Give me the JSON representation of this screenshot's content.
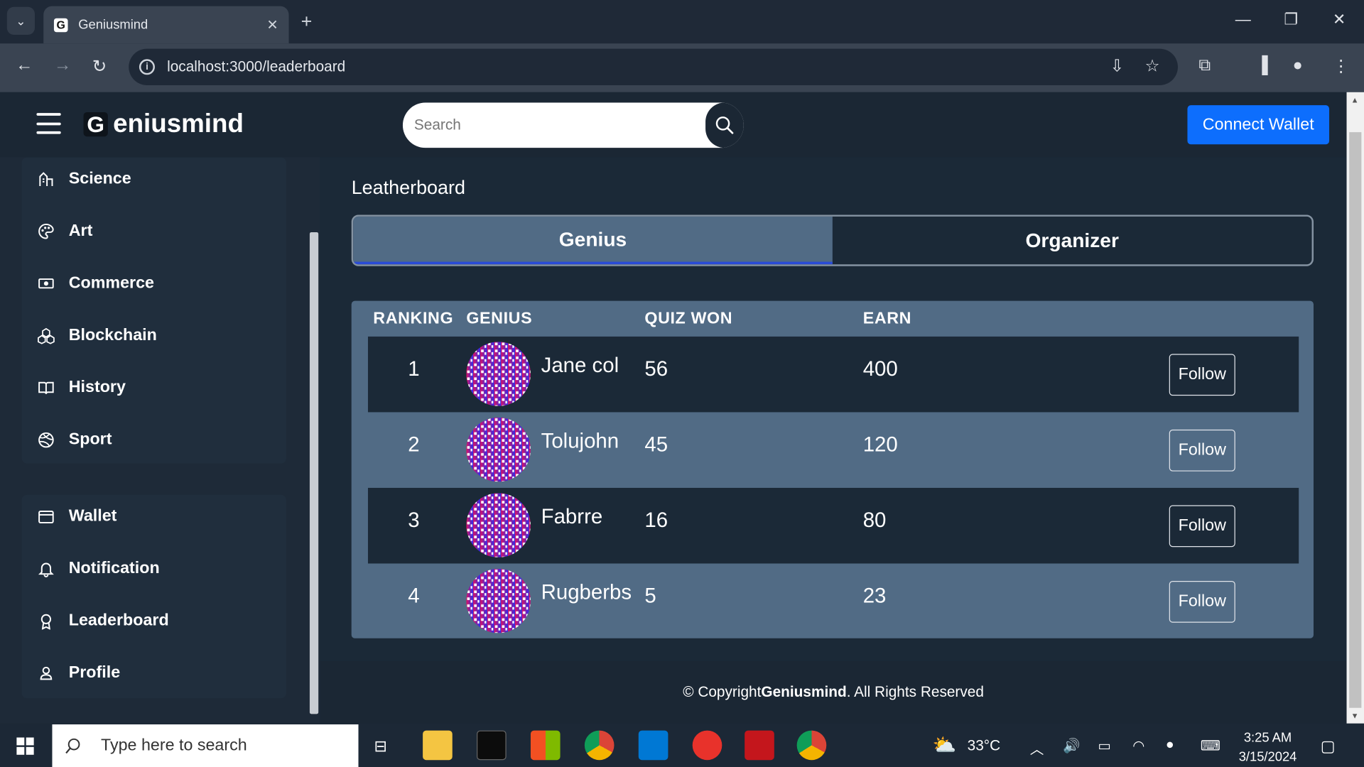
{
  "browser": {
    "tab_title": "Geniusmind",
    "url": "localhost:3000/leaderboard",
    "favicon_letter": "G"
  },
  "header": {
    "logo_letter": "G",
    "logo_text": "eniusmind",
    "search_placeholder": "Search",
    "connect_label": "Connect Wallet"
  },
  "sidebar": {
    "categories": [
      {
        "label": "Science",
        "icon": "science-icon"
      },
      {
        "label": "Art",
        "icon": "palette-icon"
      },
      {
        "label": "Commerce",
        "icon": "cash-icon"
      },
      {
        "label": "Blockchain",
        "icon": "blockchain-icon"
      },
      {
        "label": "History",
        "icon": "book-icon"
      },
      {
        "label": "Sport",
        "icon": "ball-icon"
      }
    ],
    "account": [
      {
        "label": "Wallet",
        "icon": "wallet-icon"
      },
      {
        "label": "Notification",
        "icon": "bell-icon"
      },
      {
        "label": "Leaderboard",
        "icon": "award-icon"
      },
      {
        "label": "Profile",
        "icon": "person-icon"
      }
    ]
  },
  "main": {
    "title": "Leatherboard",
    "tabs": [
      {
        "label": "Genius",
        "active": true
      },
      {
        "label": "Organizer",
        "active": false
      }
    ],
    "columns": [
      "RANKING",
      "GENIUS",
      "QUIZ WON",
      "EARN"
    ],
    "rows": [
      {
        "rank": "1",
        "name": "Jane col",
        "quiz_won": "56",
        "earn": "400",
        "action": "Follow"
      },
      {
        "rank": "2",
        "name": "Tolujohn",
        "quiz_won": "45",
        "earn": "120",
        "action": "Follow"
      },
      {
        "rank": "3",
        "name": "Fabrre",
        "quiz_won": "16",
        "earn": "80",
        "action": "Follow"
      },
      {
        "rank": "4",
        "name": "Rugberbs",
        "quiz_won": "5",
        "earn": "23",
        "action": "Follow"
      }
    ]
  },
  "footer": {
    "prefix": "© Copyright ",
    "brand": "Geniusmind",
    "suffix": ". All Rights Reserved"
  },
  "taskbar": {
    "search_placeholder": "Type here to search",
    "temperature": "33°C",
    "time": "3:25 AM",
    "date": "3/15/2024"
  },
  "colors": {
    "accent": "#0d6efd",
    "panel": "#516b85",
    "background": "#1b2937"
  }
}
